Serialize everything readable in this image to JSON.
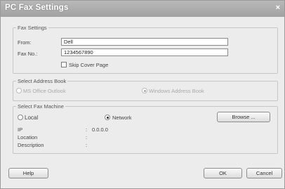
{
  "window": {
    "title": "PC Fax Settings",
    "close_glyph": "×"
  },
  "fax_settings": {
    "legend": "Fax Settings",
    "from_label": "From:",
    "from_value": "Dell",
    "fax_no_label": "Fax No.:",
    "fax_no_value": "1234567890",
    "skip_cover_label": "Skip Cover Page",
    "skip_cover_checked": false
  },
  "address_book": {
    "legend": "Select Address Book",
    "option_outlook": "MS Office Outlook",
    "option_windows": "Windows Address Book",
    "selected": "windows",
    "enabled": false
  },
  "fax_machine": {
    "legend": "Select Fax Machine",
    "option_local": "Local",
    "option_network": "Network",
    "selected": "network",
    "browse_label": "Browse ...",
    "ip_label": "IP",
    "ip_value": "0.0.0.0",
    "location_label": "Location",
    "location_value": "",
    "description_label": "Description",
    "description_value": "",
    "colon": ":"
  },
  "footer": {
    "help_label": "Help",
    "ok_label": "OK",
    "cancel_label": "Cancel"
  }
}
